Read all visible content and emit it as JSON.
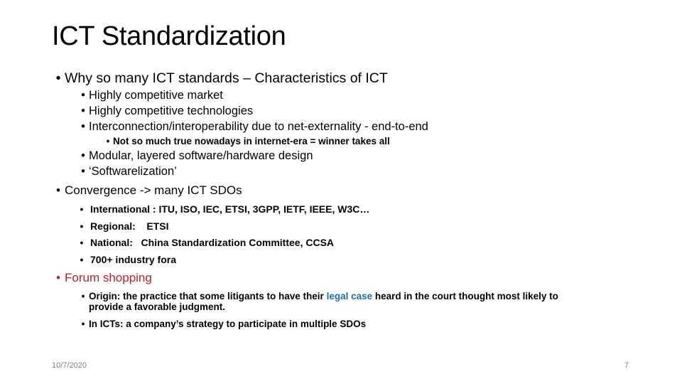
{
  "slide": {
    "title": "ICT  Standardization",
    "bullet_glyph": "•",
    "sections": {
      "why": {
        "text": "Why so many ICT standards – Characteristics of ICT",
        "items": [
          "Highly competitive market",
          "Highly competitive technologies",
          "Interconnection/interoperability due to net-externality - end-to-end"
        ],
        "subnote": "Not so much true nowadays in internet-era = winner takes all",
        "items_after": [
          "Modular, layered software/hardware design",
          "‘Softwarelization’"
        ]
      },
      "convergence": {
        "text": "Convergence -> many ICT SDOs",
        "items": [
          "International : ITU, ISO, IEC, ETSI, 3GPP, IETF, IEEE, W3C…",
          "Regional:    ETSI",
          "National:   China Standardization Committee, CCSA",
          "700+ industry fora"
        ]
      },
      "forum": {
        "text": "Forum shopping",
        "text_color": "#c0202a",
        "origin": {
          "prefix": "Origin: the practice that some litigants to have their ",
          "highlight": "legal case",
          "highlight_color": "#1f6fa3",
          "suffix": " heard in the court thought most likely to",
          "line2": "provide a favorable judgment."
        },
        "icts": "In ICTs: a company’s strategy to participate in multiple SDOs"
      }
    },
    "footer": {
      "date": "10/7/2020",
      "page_number": "7"
    }
  }
}
